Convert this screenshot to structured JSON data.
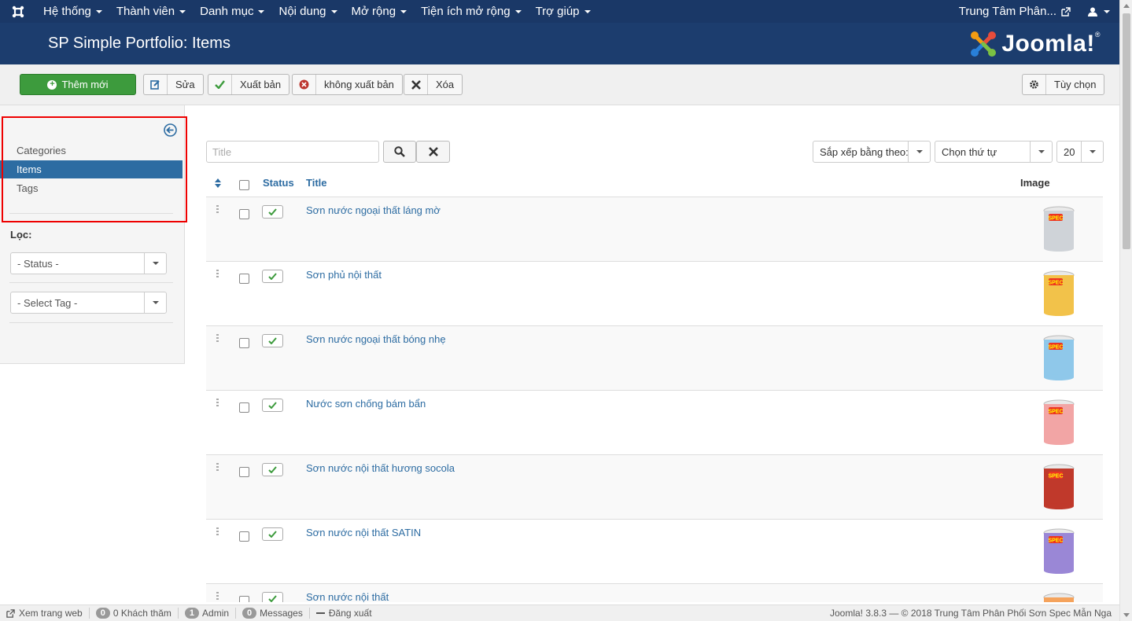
{
  "topnav": {
    "menu": [
      "Hệ thống",
      "Thành viên",
      "Danh mục",
      "Nội dung",
      "Mở rộng",
      "Tiện ích mở rộng",
      "Trợ giúp"
    ],
    "site_name": "Trung Tâm Phân..."
  },
  "header": {
    "title": "SP Simple Portfolio: Items",
    "brand": "Joomla!",
    "brand_mark": "®"
  },
  "toolbar": {
    "new_label": "Thêm mới",
    "edit_label": "Sửa",
    "publish_label": "Xuất bản",
    "unpublish_label": "không xuất bản",
    "delete_label": "Xóa",
    "options_label": "Tùy chọn"
  },
  "sidebar": {
    "items": [
      {
        "label": "Categories",
        "active": false
      },
      {
        "label": "Items",
        "active": true
      },
      {
        "label": "Tags",
        "active": false
      }
    ],
    "filter_title": "Lọc:",
    "status_filter": "- Status -",
    "tag_filter": "- Select Tag -"
  },
  "search": {
    "placeholder": "Title"
  },
  "list_controls": {
    "sort_by": "Sắp xếp bằng theo:",
    "order": "Chọn thứ tự",
    "limit": "20"
  },
  "table": {
    "headers": {
      "status": "Status",
      "title": "Title",
      "image": "Image"
    },
    "rows": [
      {
        "title": "Sơn nước ngoại thất láng mờ",
        "image_color": "#cfd3d8"
      },
      {
        "title": "Sơn phủ nội thất",
        "image_color": "#f2c24a"
      },
      {
        "title": "Sơn nước ngoại thất bóng nhẹ",
        "image_color": "#8fc8ea"
      },
      {
        "title": "Nước sơn chống bám bẩn",
        "image_color": "#f2a5a5"
      },
      {
        "title": "Sơn nước nội thất hương socola",
        "image_color": "#c0392b"
      },
      {
        "title": "Sơn nước nội thất SATIN",
        "image_color": "#9a87d6"
      },
      {
        "title": "Sơn nước nội thất",
        "image_color": "#f5a35c"
      }
    ],
    "image_label": "SPEC"
  },
  "statusbar": {
    "view_site": "Xem trang web",
    "visitors_count": "0",
    "visitors_label": "0 Khách thăm",
    "admin_count": "1",
    "admin_label": "Admin",
    "messages_count": "0",
    "messages_label": "Messages",
    "logout": "Đăng xuất",
    "copyright": "Joomla! 3.8.3  —  © 2018 Trung Tâm Phân Phối Sơn Spec Mẫn Nga"
  },
  "colors": {
    "nav_bg": "#1a3867",
    "header_bg": "#1c3d6e",
    "primary": "#3d9b3d",
    "link": "#2d6ca2",
    "highlight": "#ee0000"
  }
}
